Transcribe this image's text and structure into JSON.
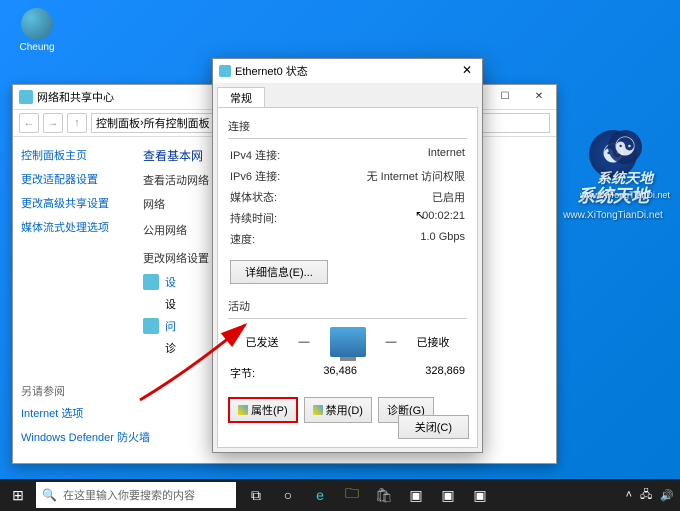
{
  "desktop": {
    "user_label": "Cheung"
  },
  "net_window": {
    "title": "网络和共享中心",
    "breadcrumb": {
      "part1": "控制面板",
      "part2": "所有控制面板"
    },
    "sidebar": {
      "home": "控制面板主页",
      "links": [
        "更改适配器设置",
        "更改高级共享设置",
        "媒体流式处理选项"
      ],
      "see_also": "另请参阅",
      "bottom_links": [
        "Internet 选项",
        "Windows Defender 防火墙"
      ]
    },
    "content": {
      "heading": "查看基本网",
      "sub": "查看活动网络",
      "net_label": "网络",
      "net_type": "公用网络",
      "change_title": "更改网络设置",
      "link1": "设",
      "link1_sub": "设",
      "link2": "问",
      "link2_sub": "诊"
    }
  },
  "dialog": {
    "title": "Ethernet0 状态",
    "tab_general": "常规",
    "group_connection": "连接",
    "rows": {
      "ipv4_label": "IPv4 连接:",
      "ipv4_value": "Internet",
      "ipv6_label": "IPv6 连接:",
      "ipv6_value": "无 Internet 访问权限",
      "media_label": "媒体状态:",
      "media_value": "已启用",
      "duration_label": "持续时间:",
      "duration_value": "00:02:21",
      "speed_label": "速度:",
      "speed_value": "1.0 Gbps"
    },
    "details_btn": "详细信息(E)...",
    "group_activity": "活动",
    "sent_label": "已发送",
    "recv_label": "已接收",
    "bytes_label": "字节:",
    "bytes_sent": "36,486",
    "bytes_recv": "328,869",
    "btn_properties": "属性(P)",
    "btn_disable": "禁用(D)",
    "btn_diagnose": "诊断(G)",
    "btn_close": "关闭(C)"
  },
  "taskbar": {
    "search_placeholder": "在这里输入你要搜索的内容"
  },
  "watermark": {
    "text": "系统天地",
    "url": "www.XiTongTianDi.net"
  }
}
